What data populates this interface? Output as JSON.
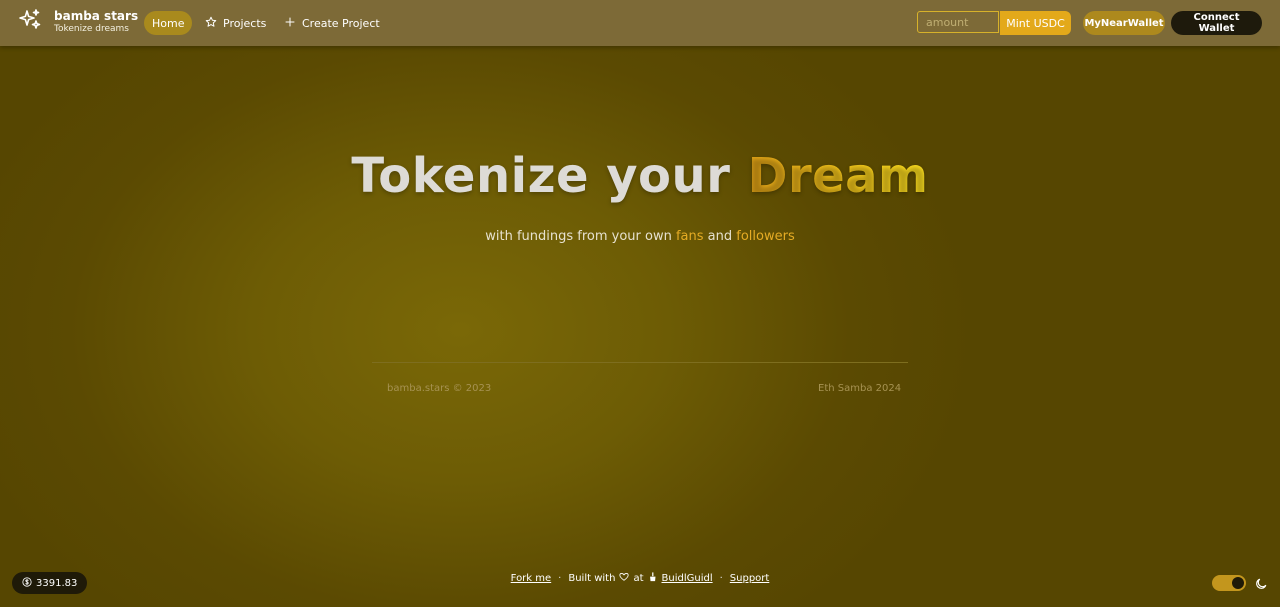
{
  "brand": {
    "title": "bamba stars",
    "subtitle": "Tokenize dreams",
    "icon": "sparkles-icon"
  },
  "nav": {
    "home": "Home",
    "projects": "Projects",
    "create_project": "Create Project"
  },
  "mint": {
    "placeholder": "amount",
    "button": "Mint USDC"
  },
  "wallet": {
    "near": "MyNearWallet",
    "connect": "Connect Wallet"
  },
  "hero": {
    "title_main": "Tokenize your ",
    "title_accent": "Dream",
    "sub_1": "with fundings from your own ",
    "sub_fans": "fans",
    "sub_and": " and ",
    "sub_followers": "followers"
  },
  "footer": {
    "left": "bamba.stars © 2023",
    "right": "Eth Samba 2024"
  },
  "price": {
    "value": "3391.83",
    "icon": "dollar-icon"
  },
  "bottom": {
    "fork": "Fork me",
    "built": "Built with",
    "at": "at",
    "buidl": "BuidlGuidl",
    "support": "Support"
  },
  "colors": {
    "nav_bg": "#7d6a37",
    "accent": "#e3a91a",
    "page_bg": "#5b4a02"
  }
}
